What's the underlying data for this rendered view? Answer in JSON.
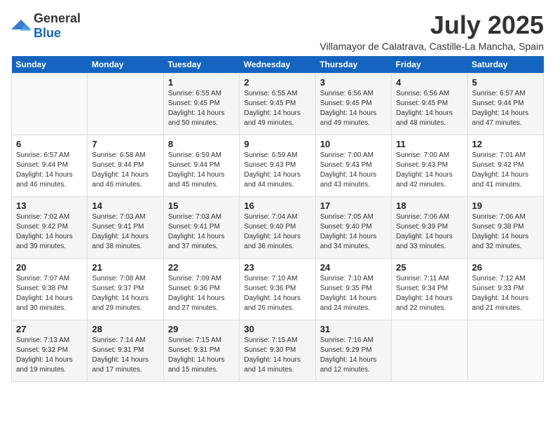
{
  "header": {
    "logo": {
      "general": "General",
      "blue": "Blue"
    },
    "title": "July 2025",
    "location": "Villamayor de Calatrava, Castille-La Mancha, Spain"
  },
  "days_of_week": [
    "Sunday",
    "Monday",
    "Tuesday",
    "Wednesday",
    "Thursday",
    "Friday",
    "Saturday"
  ],
  "weeks": [
    [
      {
        "day": "",
        "sunrise": "",
        "sunset": "",
        "daylight": ""
      },
      {
        "day": "",
        "sunrise": "",
        "sunset": "",
        "daylight": ""
      },
      {
        "day": "1",
        "sunrise": "Sunrise: 6:55 AM",
        "sunset": "Sunset: 9:45 PM",
        "daylight": "Daylight: 14 hours and 50 minutes."
      },
      {
        "day": "2",
        "sunrise": "Sunrise: 6:55 AM",
        "sunset": "Sunset: 9:45 PM",
        "daylight": "Daylight: 14 hours and 49 minutes."
      },
      {
        "day": "3",
        "sunrise": "Sunrise: 6:56 AM",
        "sunset": "Sunset: 9:45 PM",
        "daylight": "Daylight: 14 hours and 49 minutes."
      },
      {
        "day": "4",
        "sunrise": "Sunrise: 6:56 AM",
        "sunset": "Sunset: 9:45 PM",
        "daylight": "Daylight: 14 hours and 48 minutes."
      },
      {
        "day": "5",
        "sunrise": "Sunrise: 6:57 AM",
        "sunset": "Sunset: 9:44 PM",
        "daylight": "Daylight: 14 hours and 47 minutes."
      }
    ],
    [
      {
        "day": "6",
        "sunrise": "Sunrise: 6:57 AM",
        "sunset": "Sunset: 9:44 PM",
        "daylight": "Daylight: 14 hours and 46 minutes."
      },
      {
        "day": "7",
        "sunrise": "Sunrise: 6:58 AM",
        "sunset": "Sunset: 9:44 PM",
        "daylight": "Daylight: 14 hours and 46 minutes."
      },
      {
        "day": "8",
        "sunrise": "Sunrise: 6:59 AM",
        "sunset": "Sunset: 9:44 PM",
        "daylight": "Daylight: 14 hours and 45 minutes."
      },
      {
        "day": "9",
        "sunrise": "Sunrise: 6:59 AM",
        "sunset": "Sunset: 9:43 PM",
        "daylight": "Daylight: 14 hours and 44 minutes."
      },
      {
        "day": "10",
        "sunrise": "Sunrise: 7:00 AM",
        "sunset": "Sunset: 9:43 PM",
        "daylight": "Daylight: 14 hours and 43 minutes."
      },
      {
        "day": "11",
        "sunrise": "Sunrise: 7:00 AM",
        "sunset": "Sunset: 9:43 PM",
        "daylight": "Daylight: 14 hours and 42 minutes."
      },
      {
        "day": "12",
        "sunrise": "Sunrise: 7:01 AM",
        "sunset": "Sunset: 9:42 PM",
        "daylight": "Daylight: 14 hours and 41 minutes."
      }
    ],
    [
      {
        "day": "13",
        "sunrise": "Sunrise: 7:02 AM",
        "sunset": "Sunset: 9:42 PM",
        "daylight": "Daylight: 14 hours and 39 minutes."
      },
      {
        "day": "14",
        "sunrise": "Sunrise: 7:03 AM",
        "sunset": "Sunset: 9:41 PM",
        "daylight": "Daylight: 14 hours and 38 minutes."
      },
      {
        "day": "15",
        "sunrise": "Sunrise: 7:03 AM",
        "sunset": "Sunset: 9:41 PM",
        "daylight": "Daylight: 14 hours and 37 minutes."
      },
      {
        "day": "16",
        "sunrise": "Sunrise: 7:04 AM",
        "sunset": "Sunset: 9:40 PM",
        "daylight": "Daylight: 14 hours and 36 minutes."
      },
      {
        "day": "17",
        "sunrise": "Sunrise: 7:05 AM",
        "sunset": "Sunset: 9:40 PM",
        "daylight": "Daylight: 14 hours and 34 minutes."
      },
      {
        "day": "18",
        "sunrise": "Sunrise: 7:06 AM",
        "sunset": "Sunset: 9:39 PM",
        "daylight": "Daylight: 14 hours and 33 minutes."
      },
      {
        "day": "19",
        "sunrise": "Sunrise: 7:06 AM",
        "sunset": "Sunset: 9:38 PM",
        "daylight": "Daylight: 14 hours and 32 minutes."
      }
    ],
    [
      {
        "day": "20",
        "sunrise": "Sunrise: 7:07 AM",
        "sunset": "Sunset: 9:38 PM",
        "daylight": "Daylight: 14 hours and 30 minutes."
      },
      {
        "day": "21",
        "sunrise": "Sunrise: 7:08 AM",
        "sunset": "Sunset: 9:37 PM",
        "daylight": "Daylight: 14 hours and 29 minutes."
      },
      {
        "day": "22",
        "sunrise": "Sunrise: 7:09 AM",
        "sunset": "Sunset: 9:36 PM",
        "daylight": "Daylight: 14 hours and 27 minutes."
      },
      {
        "day": "23",
        "sunrise": "Sunrise: 7:10 AM",
        "sunset": "Sunset: 9:36 PM",
        "daylight": "Daylight: 14 hours and 26 minutes."
      },
      {
        "day": "24",
        "sunrise": "Sunrise: 7:10 AM",
        "sunset": "Sunset: 9:35 PM",
        "daylight": "Daylight: 14 hours and 24 minutes."
      },
      {
        "day": "25",
        "sunrise": "Sunrise: 7:11 AM",
        "sunset": "Sunset: 9:34 PM",
        "daylight": "Daylight: 14 hours and 22 minutes."
      },
      {
        "day": "26",
        "sunrise": "Sunrise: 7:12 AM",
        "sunset": "Sunset: 9:33 PM",
        "daylight": "Daylight: 14 hours and 21 minutes."
      }
    ],
    [
      {
        "day": "27",
        "sunrise": "Sunrise: 7:13 AM",
        "sunset": "Sunset: 9:32 PM",
        "daylight": "Daylight: 14 hours and 19 minutes."
      },
      {
        "day": "28",
        "sunrise": "Sunrise: 7:14 AM",
        "sunset": "Sunset: 9:31 PM",
        "daylight": "Daylight: 14 hours and 17 minutes."
      },
      {
        "day": "29",
        "sunrise": "Sunrise: 7:15 AM",
        "sunset": "Sunset: 9:31 PM",
        "daylight": "Daylight: 14 hours and 15 minutes."
      },
      {
        "day": "30",
        "sunrise": "Sunrise: 7:15 AM",
        "sunset": "Sunset: 9:30 PM",
        "daylight": "Daylight: 14 hours and 14 minutes."
      },
      {
        "day": "31",
        "sunrise": "Sunrise: 7:16 AM",
        "sunset": "Sunset: 9:29 PM",
        "daylight": "Daylight: 14 hours and 12 minutes."
      },
      {
        "day": "",
        "sunrise": "",
        "sunset": "",
        "daylight": ""
      },
      {
        "day": "",
        "sunrise": "",
        "sunset": "",
        "daylight": ""
      }
    ]
  ]
}
